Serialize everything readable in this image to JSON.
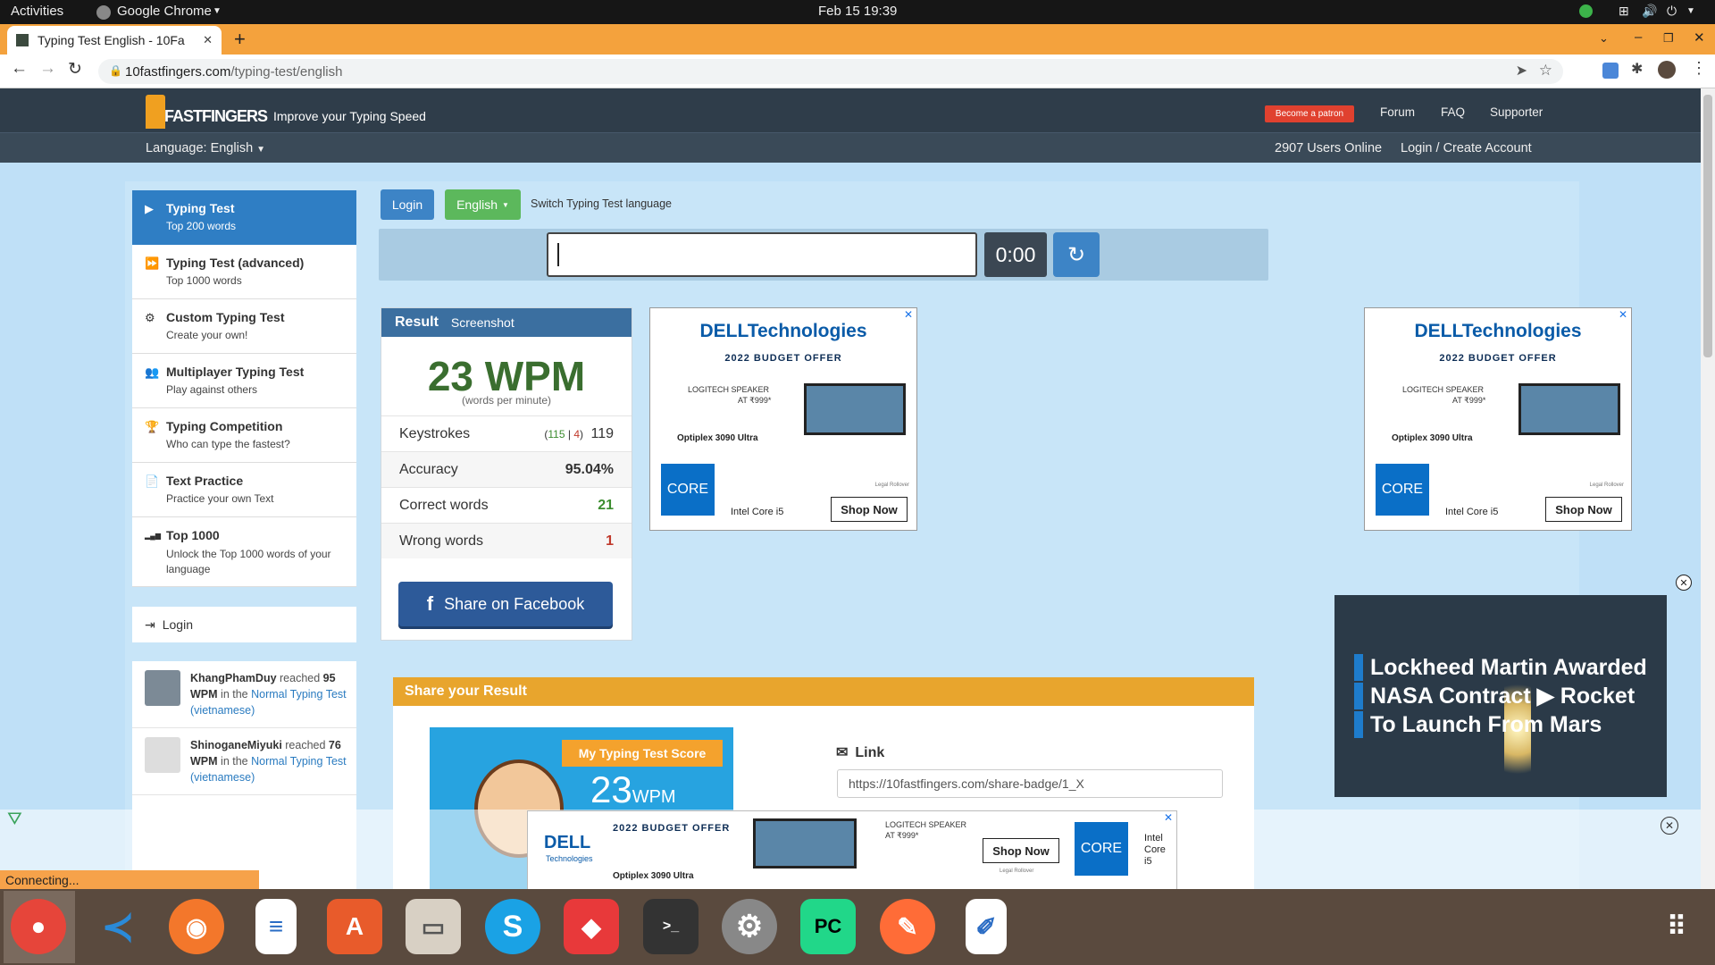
{
  "os": {
    "activities": "Activities",
    "app": "Google Chrome",
    "clock": "Feb 15  19:39"
  },
  "browser": {
    "tab_title": "Typing Test English - 10Fa",
    "url_domain": "10fastfingers.com",
    "url_path": "/typing-test/english"
  },
  "site": {
    "logo": "FASTFINGERS",
    "tagline": "Improve your Typing Speed",
    "patron": "Become a patron",
    "nav": [
      "Forum",
      "FAQ",
      "Supporter"
    ],
    "language_menu": "Language: English",
    "users_online": "2907 Users Online",
    "login_create": "Login / Create Account"
  },
  "sidebar": {
    "items": [
      {
        "title": "Typing Test",
        "sub": "Top 200 words",
        "icon": "play-icon",
        "glyph": "▶"
      },
      {
        "title": "Typing Test (advanced)",
        "sub": "Top 1000 words",
        "icon": "fast-forward-icon",
        "glyph": "⏩"
      },
      {
        "title": "Custom Typing Test",
        "sub": "Create your own!",
        "icon": "cogs-icon",
        "glyph": "⚙"
      },
      {
        "title": "Multiplayer Typing Test",
        "sub": "Play against others",
        "icon": "users-icon",
        "glyph": "👥"
      },
      {
        "title": "Typing Competition",
        "sub": "Who can type the fastest?",
        "icon": "trophy-icon",
        "glyph": "🏆"
      },
      {
        "title": "Text Practice",
        "sub": "Practice your own Text",
        "icon": "file-icon",
        "glyph": "📄"
      },
      {
        "title": "Top 1000",
        "sub": "Unlock the Top 1000 words of your language",
        "icon": "signal-icon",
        "glyph": "▂▄▆"
      }
    ],
    "login": "Login"
  },
  "feed": [
    {
      "user": "KhangPhamDuy",
      "mid": " reached ",
      "wpm": "95 WPM",
      "in": " in the ",
      "test": "Normal Typing Test (vietnamese)"
    },
    {
      "user": "ShinoganeMiyuki",
      "mid": " reached ",
      "wpm": "76 WPM",
      "in": " in the ",
      "test": "Normal Typing Test (vietnamese)"
    }
  ],
  "controls": {
    "login": "Login",
    "language": "English",
    "switch_label": "Switch Typing Test language",
    "timer": "0:00"
  },
  "result": {
    "header": "Result",
    "screenshot": "Screenshot",
    "wpm": "23 WPM",
    "wpm_sub": "(words per minute)",
    "keystrokes_label": "Keystrokes",
    "keystrokes_correct": "115",
    "keystrokes_wrong": "4",
    "keystrokes_total": "119",
    "accuracy_label": "Accuracy",
    "accuracy": "95.04%",
    "correct_label": "Correct words",
    "correct": "21",
    "wrong_label": "Wrong words",
    "wrong": "1",
    "share_fb": "Share on Facebook"
  },
  "share": {
    "header": "Share your Result",
    "badge_title": "My Typing Test Score",
    "badge_value": "23",
    "badge_unit": "WPM",
    "link_label": "Link",
    "link_value": "https://10fastfingers.com/share-badge/1_X"
  },
  "ads": {
    "brand": "DELLTechnologies",
    "offer": "2022 BUDGET OFFER",
    "speaker": "LOGITECH SPEAKER",
    "speaker_price": "AT ₹999*",
    "product": "Optiplex 3090 Ultra",
    "chip": "Intel Core i5",
    "shop": "Shop Now",
    "legal": "Legal Rollover",
    "bottom_brand": "DELL",
    "bottom_brand_sub": "Technologies",
    "bottom_chip": "Intel Core i5"
  },
  "video": {
    "line1": "Lockheed Martin Awarded",
    "line2": "NASA Contract",
    "line2b": "Rocket",
    "line3": "To Launch From Mars"
  },
  "status": "Connecting...",
  "colors": {
    "accent": "#2f7ec4",
    "green": "#5cb85c",
    "orange": "#e8a52d",
    "header": "#2f3d4a"
  }
}
